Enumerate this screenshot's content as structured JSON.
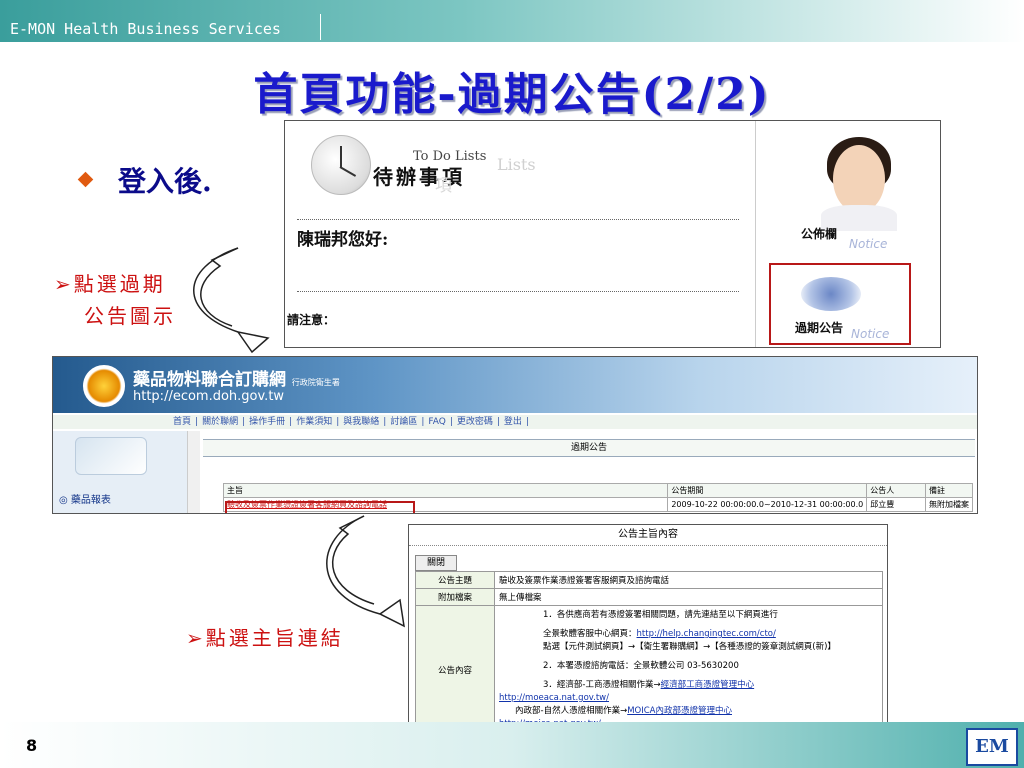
{
  "header": {
    "company": "E-MON Health Business Services"
  },
  "slide": {
    "title": "首頁功能-過期公告(2/2)",
    "bullet": "登入後.",
    "note1_line1": "➢點選過期",
    "note1_line2": "公告圖示",
    "note2": "➢點選主旨連結",
    "page_number": "8",
    "logo_text": "EM"
  },
  "screenshot_home": {
    "todo_en": "To Do Lists",
    "todo_ghost": "Lists",
    "todo_title": "待辦事項",
    "todo_ghost2": "項",
    "greeting": "陳瑞邦您好:",
    "note_label": "請注意：",
    "bulletin_label": "公佈欄",
    "notice_word": "Notice",
    "expired_label": "過期公告",
    "expired_notice": "Notice"
  },
  "screenshot_portal": {
    "site_title": "藥品物料聯合訂購網",
    "site_subtitle": "行政院衛生署",
    "site_url": "http://ecom.doh.gov.tw",
    "nav": [
      "首頁",
      "關於聯網",
      "操作手冊",
      "作業須知",
      "與我聯絡",
      "討論區",
      "FAQ",
      "更改密碼",
      "登出"
    ],
    "side_item": "◎ 藥品報表",
    "panel_title": "過期公告",
    "table_headers": [
      "主旨",
      "公告期間",
      "公告人",
      "備註"
    ],
    "table_row": [
      "驗收及簽票作業憑證簽署客服網頁及諮詢電話",
      "2009-10-22 00:00:00.0~2010-12-31 00:00:00.0",
      "邱立豐",
      "無附加檔案"
    ]
  },
  "screenshot_detail": {
    "head": "公告主旨內容",
    "close_button": "關閉",
    "subject_label": "公告主題",
    "subject_value": "驗收及簽票作業憑證簽署客服網頁及諮詢電話",
    "attachment_label": "附加檔案",
    "attachment_value": "無上傳檔案",
    "content_label": "公告內容",
    "content_line1": "1．各供應商若有憑證簽署相關問題，請先連結至以下網頁進行",
    "content_line2_prefix": "全景軟體客服中心網頁：",
    "content_line2_link": "http://help.changingtec.com/cto/",
    "content_line3": "點選【元件測試網頁】→【衛生署聯購網】→【各種憑證的簽章測試網頁(新)】",
    "content_line4": "2．本署憑證諮詢電話：全景軟體公司 03-5630200",
    "content_line5_prefix": "3．經濟部-工商憑證相關作業→",
    "content_line5_link": "經濟部工商憑證管理中心",
    "content_line6_link": "http://moeaca.nat.gov.tw/",
    "content_line7_prefix": "內政部-自然人憑證相關作業→",
    "content_line7_link": "MOICA內政部憑證管理中心",
    "content_line8_link": "http://moica.nat.gov.tw/"
  },
  "colors": {
    "title": "#1a1acc",
    "note": "#cc1111",
    "highlight_box": "#b81818",
    "header_teal": "#3a9e9c"
  }
}
